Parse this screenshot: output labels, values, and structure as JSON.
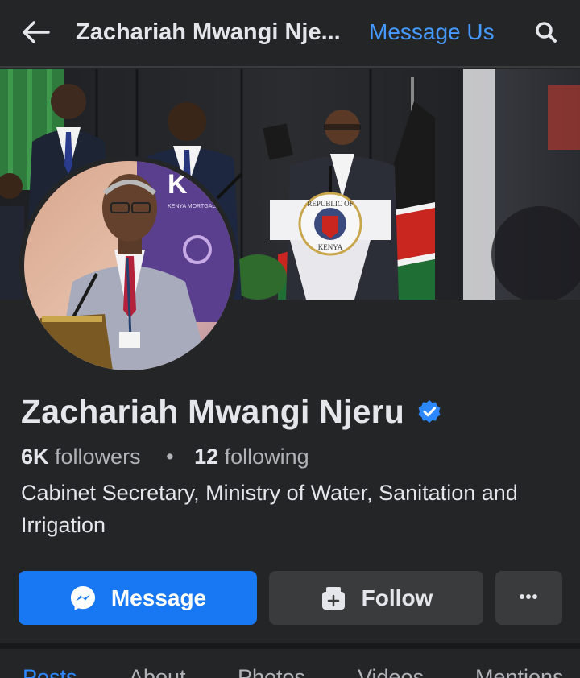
{
  "header": {
    "title": "Zachariah Mwangi Nje...",
    "message_us": "Message Us",
    "back_icon": "arrow-left-icon",
    "search_icon": "search-icon"
  },
  "cover": {
    "seal_text_top": "REPUBLIC OF",
    "seal_text_bottom": "KENYA",
    "banner_text": "KENYA MORTGAGE"
  },
  "profile": {
    "name": "Zachariah Mwangi Njeru",
    "followers_count": "6K",
    "followers_label": "followers",
    "separator": "•",
    "following_count": "12",
    "following_label": "following",
    "bio": "Cabinet Secretary, Ministry of Water, Sanitation and Irrigation"
  },
  "actions": {
    "message": "Message",
    "follow": "Follow",
    "more": "•••"
  },
  "tabs": [
    {
      "label": "Posts",
      "active": true
    },
    {
      "label": "About"
    },
    {
      "label": "Photos"
    },
    {
      "label": "Videos"
    },
    {
      "label": "Mentions"
    }
  ],
  "colors": {
    "background": "#242526",
    "accent": "#1877f2",
    "link": "#4599ff",
    "verified": "#2d88ff"
  }
}
